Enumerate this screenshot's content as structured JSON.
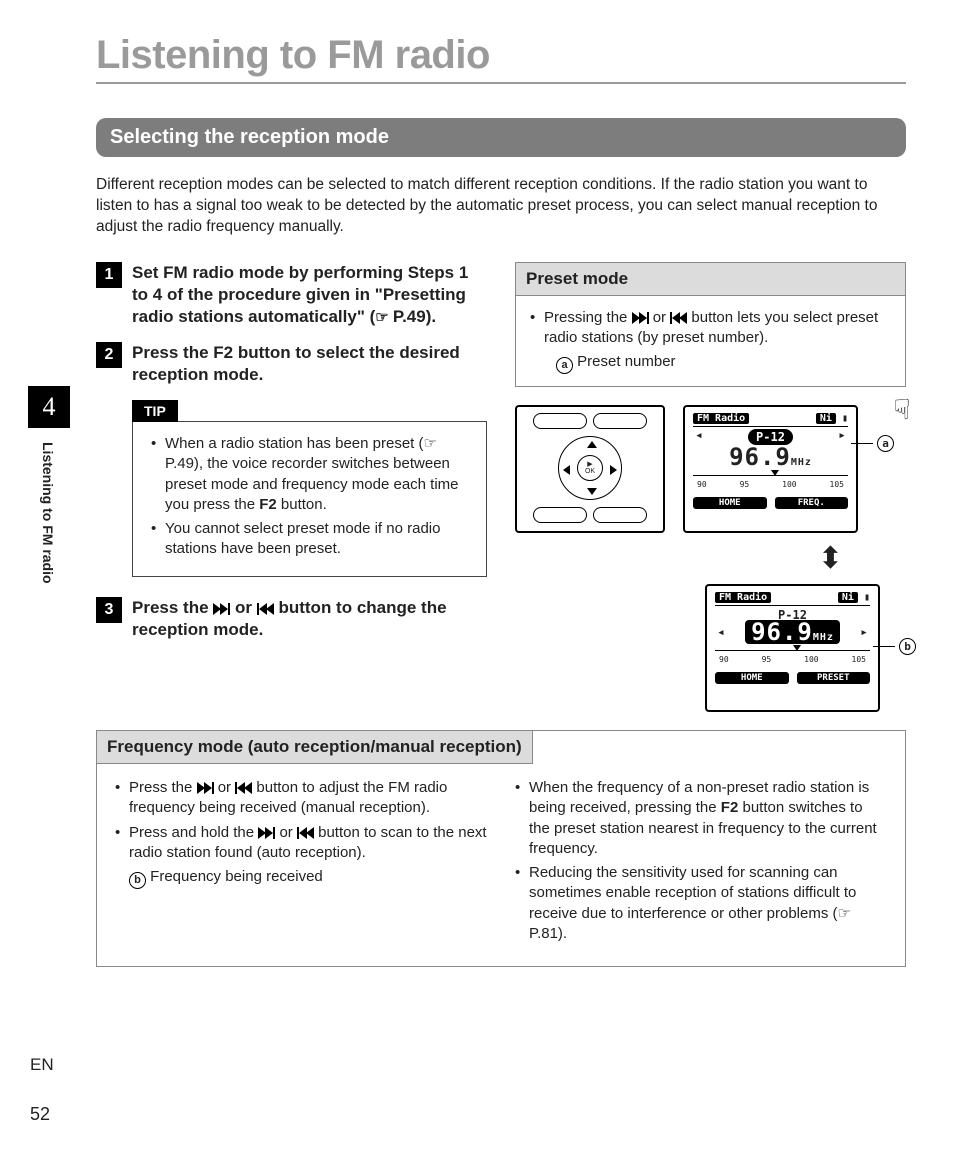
{
  "page": {
    "title": "Listening to FM radio",
    "section": "Selecting the reception mode",
    "intro": "Different reception modes can be selected to match different reception conditions. If the radio station you want to listen to has a signal too weak to be detected by the automatic preset process, you can select manual reception to adjust the radio frequency manually.",
    "chapter_number": "4",
    "side_label": "Listening to FM radio",
    "lang": "EN",
    "page_number": "52"
  },
  "steps": {
    "s1": {
      "num": "1",
      "text_a": "Set FM radio mode by performing Steps 1 to 4 of the procedure given in \"",
      "text_b": "Presetting radio stations automatically",
      "text_c": "\" (",
      "ref": "P.49",
      "text_d": ")."
    },
    "s2": {
      "num": "2",
      "text_a": "Press the ",
      "key": "F2",
      "text_b": " button to select the desired reception mode."
    },
    "s3": {
      "num": "3",
      "text_a": "Press the ",
      "text_b": " or ",
      "text_c": " button to change the reception mode."
    }
  },
  "tip": {
    "label": "TIP",
    "item1_a": "When a radio station has been preset (☞ P.49), the voice recorder switches between preset mode and frequency mode each time you press the ",
    "item1_key": "F2",
    "item1_b": " button.",
    "item2": "You cannot select preset mode if no radio stations have been preset."
  },
  "preset_panel": {
    "title": "Preset mode",
    "item1_a": "Pressing the ",
    "item1_b": " or ",
    "item1_c": " button lets you select preset radio stations (by preset number).",
    "callout_a": "a",
    "callout_a_label": "Preset number"
  },
  "screens": {
    "header": "FM Radio",
    "battery": "Ni",
    "preset_label": "P-12",
    "frequency": "96.9",
    "unit": "MHz",
    "scale": [
      "90",
      "95",
      "100",
      "105"
    ],
    "footer1_left": "HOME",
    "footer1_right": "FREQ.",
    "footer2_left": "HOME",
    "footer2_right": "PRESET",
    "ok": "OK",
    "callout_b": "b"
  },
  "freq_panel": {
    "title": "Frequency mode (auto reception/manual reception)",
    "left": {
      "item1_a": "Press the ",
      "item1_b": " or ",
      "item1_c": " button to adjust the FM radio frequency being received (manual reception).",
      "item2_a": "Press and hold the ",
      "item2_b": " or ",
      "item2_c": " button to scan to the next radio station found (auto reception).",
      "callout_b": "b",
      "callout_b_label": "Frequency being received"
    },
    "right": {
      "item1_a": "When the frequency of a non-preset radio station is being received, pressing the ",
      "item1_key": "F2",
      "item1_b": " button switches to the preset station nearest in frequency to the current frequency.",
      "item2": "Reducing the sensitivity used for scanning can sometimes enable reception of stations difficult to receive due to interference or other problems (☞ P.81)."
    }
  }
}
